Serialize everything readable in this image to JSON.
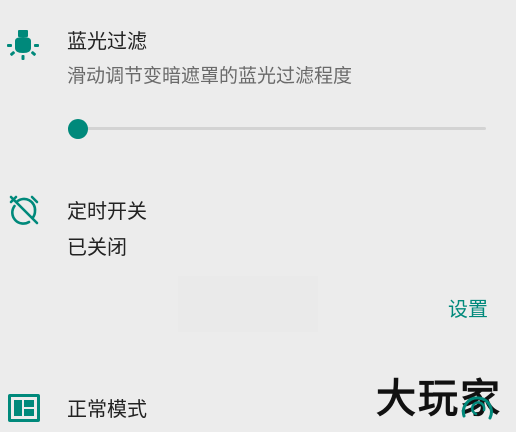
{
  "blue_filter": {
    "icon": "lightbulb-icon",
    "title": "蓝光过滤",
    "description": "滑动调节变暗遮罩的蓝光过滤程度",
    "slider_level": 0.02
  },
  "schedule": {
    "icon": "alarm-off-icon",
    "title": "定时开关",
    "status": "已关闭",
    "settings_label": "设置"
  },
  "mode": {
    "icon": "mode-grid-icon",
    "title": "正常模式"
  },
  "watermark": {
    "text": "大玩家"
  },
  "colors": {
    "accent": "#00897b",
    "background": "#ececec",
    "primary_text": "#222222",
    "secondary_text": "#6a6a6a",
    "track": "#d3d3d3"
  }
}
